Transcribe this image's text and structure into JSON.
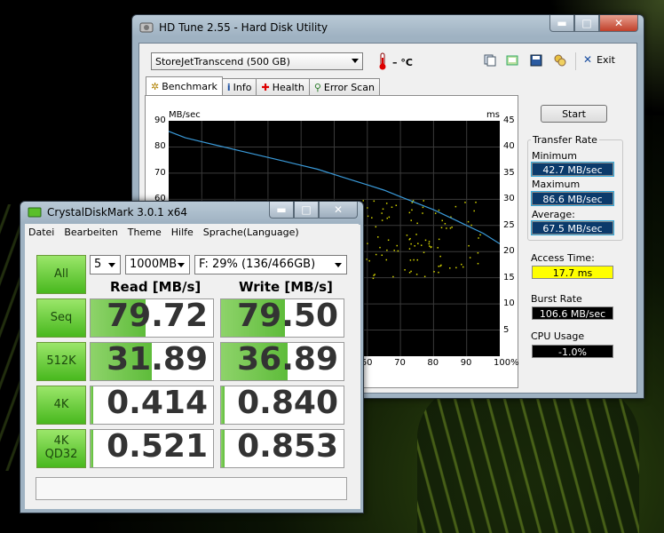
{
  "hdtune": {
    "title": "HD Tune 2.55 - Hard Disk Utility",
    "drive": "StoreJetTranscend (500 GB)",
    "temperature": "– °C",
    "exit_label": "Exit",
    "tabs": [
      {
        "label": "Benchmark",
        "icon": "benchmark-icon"
      },
      {
        "label": "Info",
        "icon": "info-icon"
      },
      {
        "label": "Health",
        "icon": "health-icon"
      },
      {
        "label": "Error Scan",
        "icon": "error-scan-icon"
      }
    ],
    "start_label": "Start",
    "transfer_rate_label": "Transfer Rate",
    "minimum_label": "Minimum",
    "minimum_value": "42.7 MB/sec",
    "maximum_label": "Maximum",
    "maximum_value": "86.6 MB/sec",
    "average_label": "Average:",
    "average_value": "67.5 MB/sec",
    "access_time_label": "Access Time:",
    "access_time_value": "17.7 ms",
    "burst_rate_label": "Burst Rate",
    "burst_rate_value": "106.6 MB/sec",
    "cpu_usage_label": "CPU Usage",
    "cpu_usage_value": "-1.0%",
    "accent_color": "#0b3a6b",
    "access_color": "#ffff00"
  },
  "chart_data": {
    "type": "line",
    "y_left_label": "MB/sec",
    "y_right_label": "ms",
    "y_left_ticks": [
      "90",
      "80",
      "70",
      "60"
    ],
    "y_right_ticks": [
      "45",
      "40",
      "35",
      "30",
      "25",
      "20",
      "15",
      "10",
      "5"
    ],
    "x_ticks": [
      "60",
      "70",
      "80",
      "90",
      "100%"
    ],
    "ylim_left": [
      0,
      90
    ],
    "ylim_right": [
      0,
      45
    ],
    "xlim": [
      0,
      100
    ],
    "series": [
      {
        "color": "#3a9ad9",
        "x": [
          0,
          5,
          10,
          15,
          20,
          25,
          30,
          35,
          40,
          45,
          50,
          55,
          60,
          65,
          70,
          75,
          80,
          85,
          90,
          95,
          100
        ],
        "y": [
          86,
          83.5,
          82,
          80.5,
          79,
          77.5,
          76,
          74.5,
          73,
          71.5,
          69.5,
          67.5,
          65.5,
          63.5,
          61,
          58.5,
          56,
          53,
          50,
          47,
          43
        ]
      }
    ],
    "scatter": {
      "color": "#d4d400",
      "description_range_ms": [
        15,
        30
      ]
    }
  },
  "cdm": {
    "title": "CrystalDiskMark 3.0.1 x64",
    "menu": [
      "Datei",
      "Bearbeiten",
      "Theme",
      "Hilfe",
      "Sprache(Language)"
    ],
    "count": "5",
    "size": "1000MB",
    "drive": "F: 29% (136/466GB)",
    "all_label": "All",
    "read_header": "Read [MB/s]",
    "write_header": "Write [MB/s]",
    "rows": [
      {
        "label": "Seq",
        "read": "79.72",
        "write": "79.50",
        "read_fill": 0.45,
        "write_fill": 0.52
      },
      {
        "label": "512K",
        "read": "31.89",
        "write": "36.89",
        "read_fill": 0.5,
        "write_fill": 0.54
      },
      {
        "label": "4K",
        "read": "0.414",
        "write": "0.840",
        "read_fill": 0.02,
        "write_fill": 0.03
      },
      {
        "label": "4K\nQD32",
        "read": "0.521",
        "write": "0.853",
        "read_fill": 0.02,
        "write_fill": 0.03
      }
    ]
  }
}
